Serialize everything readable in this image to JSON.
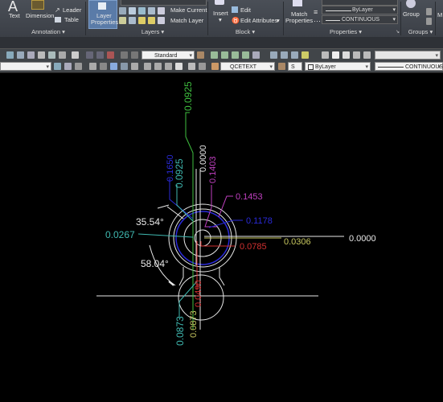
{
  "ribbon": {
    "annotation": {
      "text_label": "Text",
      "dimension_label": "Dimension",
      "leader_label": "Leader",
      "table_label": "Table",
      "panel_label": "Annotation"
    },
    "layers": {
      "layer_properties_label": "Layer\nProperties",
      "layer_properties_line1": "Layer",
      "layer_properties_line2": "Properties",
      "make_current_label": "Make Current",
      "match_layer_label": "Match Layer",
      "panel_label": "Layers"
    },
    "block": {
      "insert_label": "Insert",
      "edit_label": "Edit",
      "edit_attributes_label": "Edit Attributes",
      "panel_label": "Block"
    },
    "properties": {
      "match_properties_line1": "Match",
      "match_properties_line2": "Properties",
      "color_value": "ByLayer",
      "lineweight_value": "ByLayer",
      "linetype_value": "CONTINUOUS",
      "panel_label": "Properties"
    },
    "groups": {
      "group_label": "Group",
      "panel_label": "Groups"
    }
  },
  "toolbar1": {
    "text_style": "Standard",
    "blank_combo": ""
  },
  "toolbar2": {
    "layer_combo": "",
    "text_layer": "QCETEXT",
    "small_field": "S",
    "color_combo": "ByLayer",
    "linetype_combo": "CONTINUOUS"
  },
  "drawing": {
    "colors": {
      "green": "#3fbf3f",
      "white": "#e8e8e8",
      "blue": "#2a2ad8",
      "cyan": "#3fb8b0",
      "magenta": "#c040c0",
      "red": "#d03030",
      "yellow": "#c8c860"
    },
    "dims": {
      "top_green": "0.0925",
      "white_vert": "0.0000",
      "magenta_vert": "0.1403",
      "blue_vert": "0.1650",
      "cyan_vert": "0.0925",
      "magenta_horiz": "0.1453",
      "blue_horiz": "0.1178",
      "angle_upper": "35.54°",
      "cyan_horiz": "0.0267",
      "yellow_horiz": "0.0306",
      "white_horiz": "0.0000",
      "red_horiz": "0.0785",
      "angle_lower": "58.04°",
      "red_vert": "0.0490",
      "cyan_bottom": "0.0873",
      "yellow_bottom": "0.0873"
    }
  }
}
